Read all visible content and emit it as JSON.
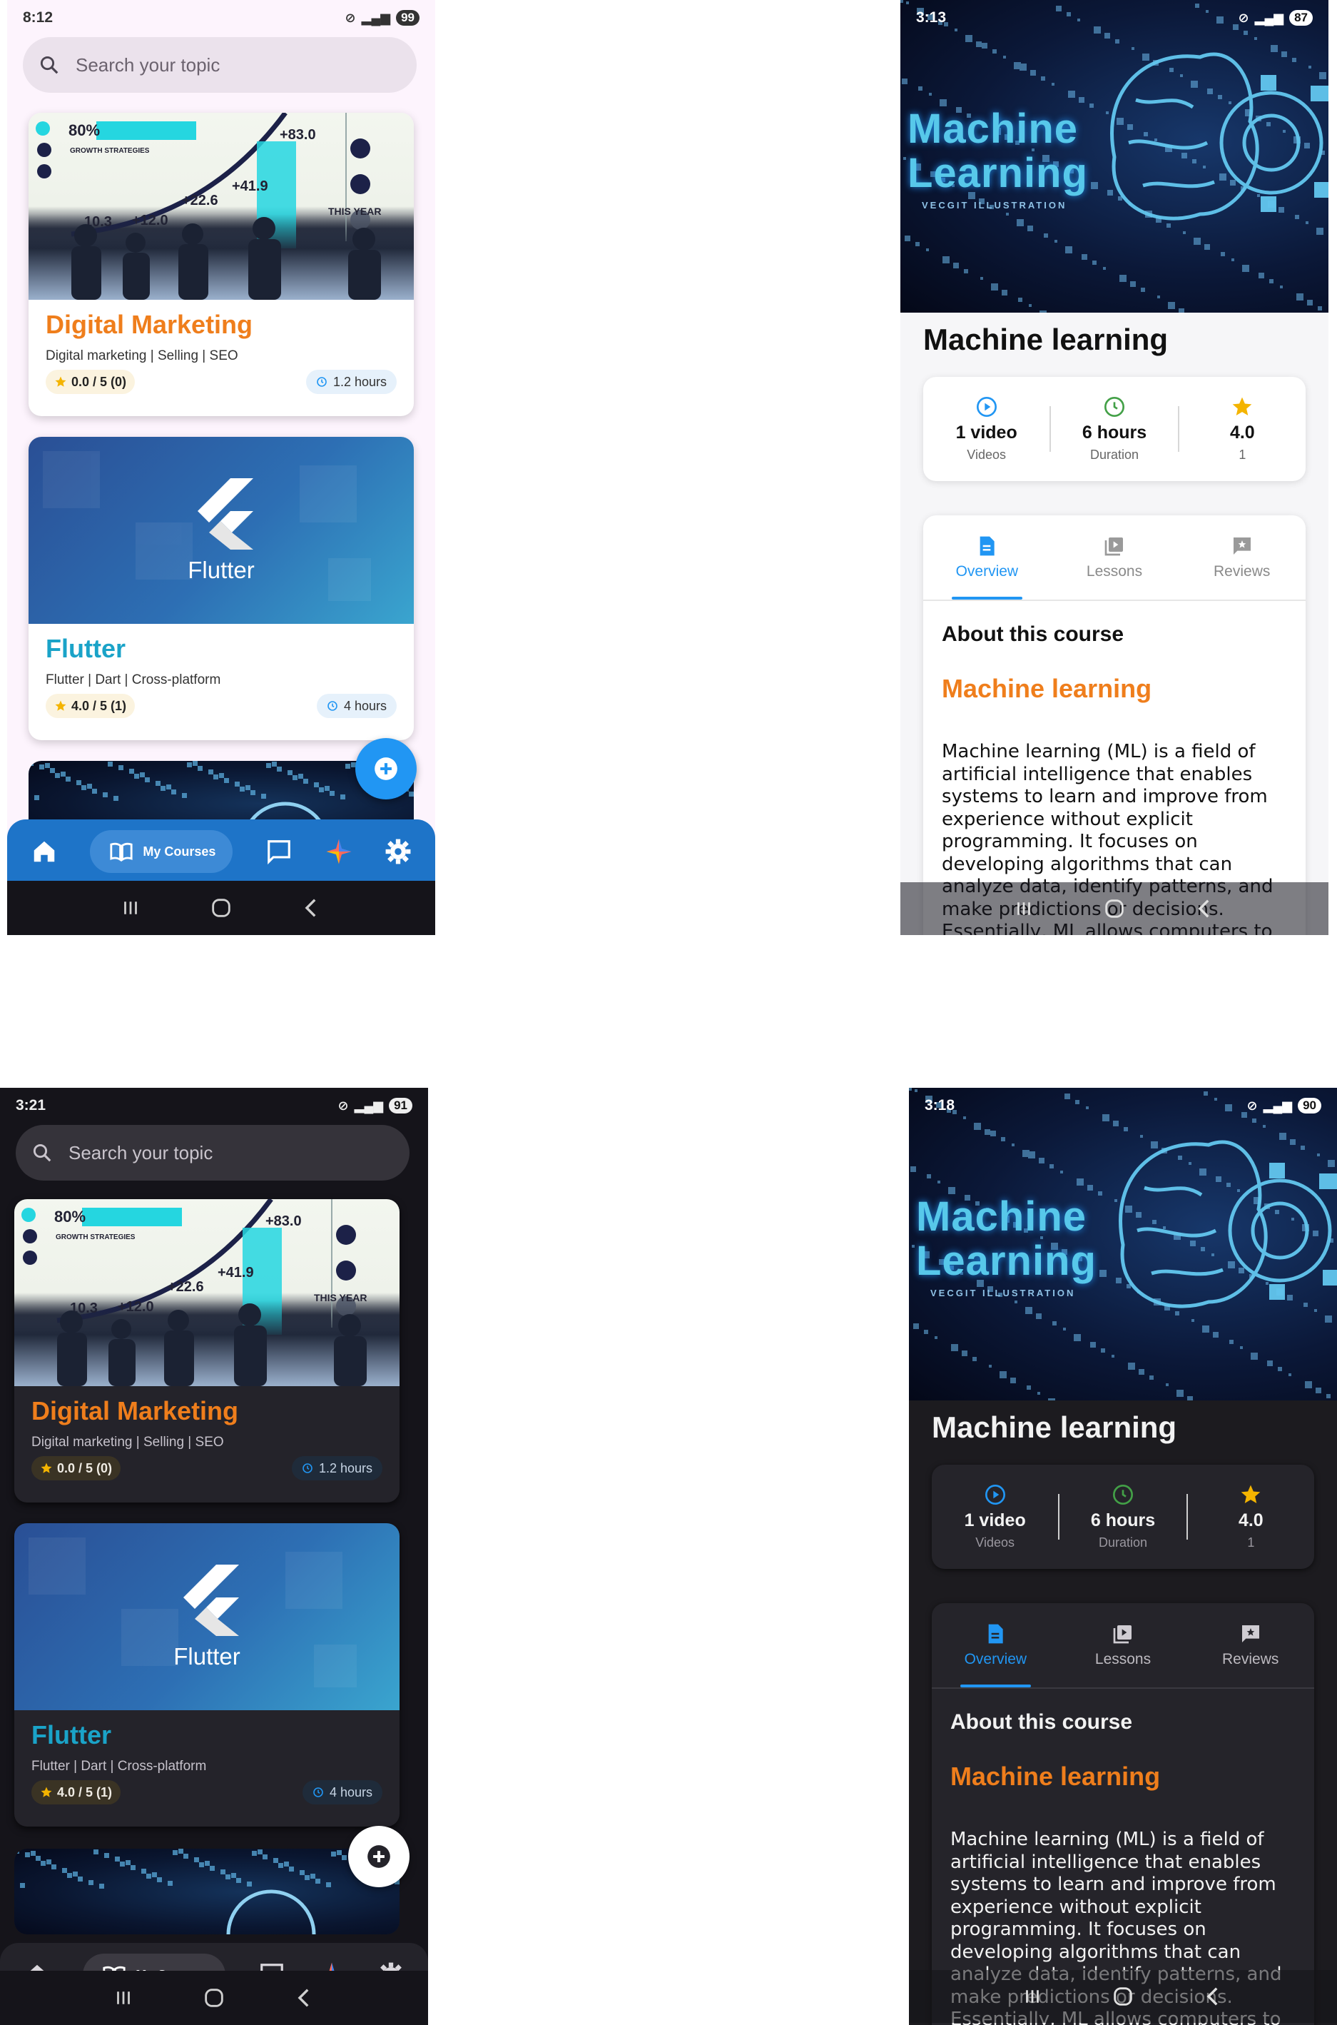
{
  "accent": "#2196f3",
  "orange": "#ef7e1c",
  "teal": "#1aa3c8",
  "screens": {
    "light_list": {
      "status": {
        "time": "8:12",
        "battery": "99"
      },
      "search_placeholder": "Search your topic",
      "courses": [
        {
          "title": "Digital Marketing",
          "tags": "Digital marketing | Selling | SEO",
          "rating": "0.0 / 5 (0)",
          "duration": "1.2 hours"
        },
        {
          "title": "Flutter",
          "tags": "Flutter  | Dart | Cross-platform",
          "rating": "4.0 / 5 (1)",
          "duration": "4 hours"
        }
      ],
      "nav_active_label": "My Courses"
    },
    "light_detail": {
      "status": {
        "time": "3:13",
        "battery": "87"
      }
    },
    "dark_list": {
      "status": {
        "time": "3:21",
        "battery": "91"
      },
      "search_placeholder": "Search your topic",
      "courses": [
        {
          "title": "Digital Marketing",
          "tags": "Digital marketing | Selling | SEO",
          "rating": "0.0 / 5 (0)",
          "duration": "1.2 hours"
        },
        {
          "title": "Flutter",
          "tags": "Flutter  | Dart | Cross-platform",
          "rating": "4.0 / 5 (1)",
          "duration": "4 hours"
        }
      ],
      "nav_active_label": "My Courses"
    },
    "dark_detail": {
      "status": {
        "time": "3:18",
        "battery": "90"
      }
    }
  },
  "image_texts": {
    "marketing": {
      "big": "80%",
      "growth": "GROWTH STRATEGIES",
      "n1": "+83.0",
      "n2": "+41.9",
      "n3": "+22.6",
      "n4": "+12.0",
      "n5": "10.3",
      "year": "THIS YEAR"
    },
    "flutter_logo_text": "Flutter",
    "ml_hero_line1": "Machine",
    "ml_hero_line2": "Learning",
    "ml_hero_sub": "VECGIT ILLUSTRATION"
  },
  "detail": {
    "title": "Machine learning",
    "stats": [
      {
        "value": "1 video",
        "label": "Videos",
        "icon": "play-circle-icon"
      },
      {
        "value": "6 hours",
        "label": "Duration",
        "icon": "clock-icon"
      },
      {
        "value": "4.0",
        "label": "1",
        "icon": "star-icon"
      }
    ],
    "tabs": [
      {
        "label": "Overview",
        "icon": "document-icon"
      },
      {
        "label": "Lessons",
        "icon": "video-library-icon"
      },
      {
        "label": "Reviews",
        "icon": "rate-review-icon"
      }
    ],
    "about_heading": "About this course",
    "course_name": "Machine learning",
    "description": "Machine learning (ML) is a field of artificial intelligence that enables systems to learn and improve from experience without explicit programming. It focuses on developing algorithms that can analyze data, identify patterns, and make predictions or decisions. Essentially, ML allows computers to learn from data and"
  }
}
